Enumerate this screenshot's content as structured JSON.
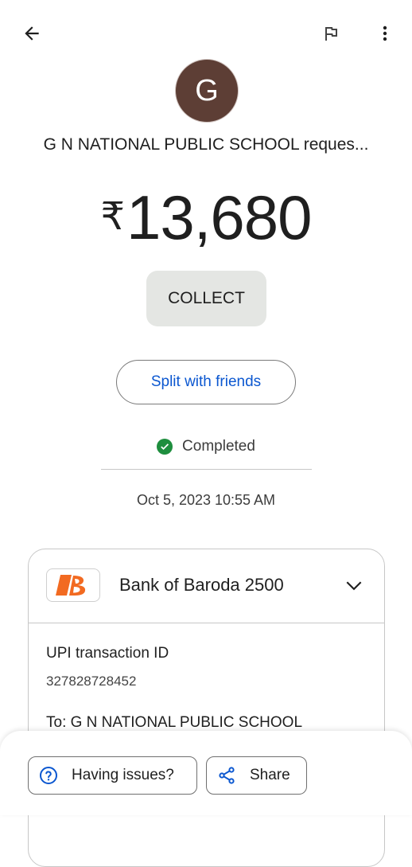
{
  "header": {
    "back_icon": "arrow-back-icon",
    "flag_icon": "flag-icon",
    "more_icon": "more-vert-icon"
  },
  "payee": {
    "avatar_letter": "G",
    "avatar_color": "#5d3e35",
    "title": "G N NATIONAL PUBLIC SCHOOL reques..."
  },
  "amount": {
    "currency": "₹",
    "value": "13,680"
  },
  "collect_label": "COLLECT",
  "split_label": "Split with friends",
  "status": {
    "text": "Completed",
    "color": "#1e8e3e"
  },
  "datetime": "Oct 5, 2023 10:55 AM",
  "bank_card": {
    "bank_name": "Bank of Baroda 2500",
    "logo_icon": "bank-of-baroda-logo",
    "upi_label": "UPI transaction ID",
    "upi_id": "327828728452",
    "to_text": "To: G N NATIONAL PUBLIC SCHOOL"
  },
  "bottom_actions": {
    "issues_label": "Having issues?",
    "share_label": "Share",
    "accent": "#0b57d0"
  }
}
